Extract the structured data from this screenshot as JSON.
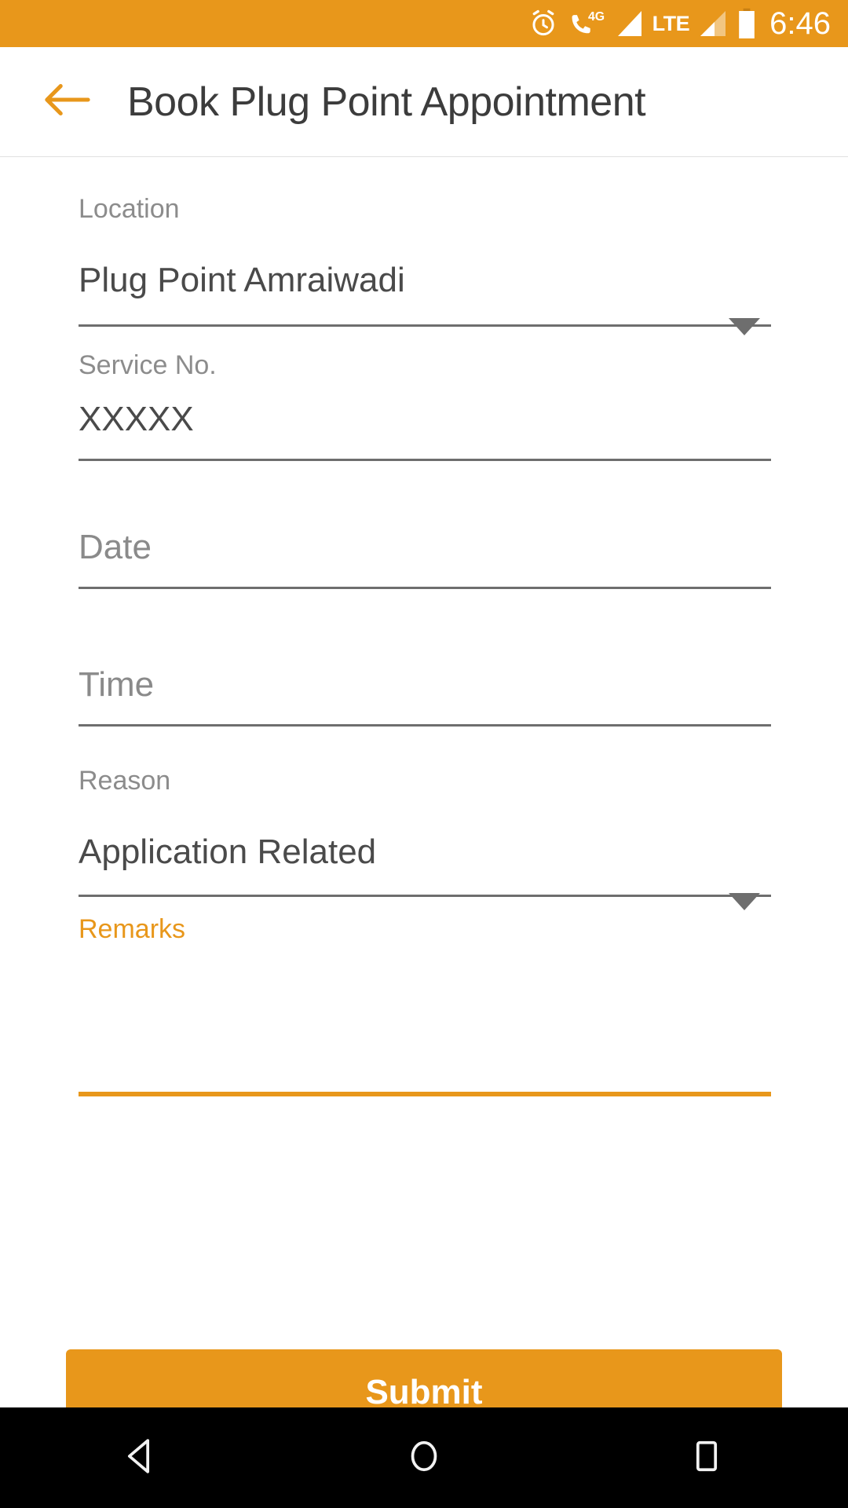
{
  "status_bar": {
    "background_color": "#e8971b",
    "icons": [
      {
        "name": "alarm-clock-icon",
        "label": ""
      },
      {
        "name": "phone-4g-icon",
        "label": "4G"
      },
      {
        "name": "signal-bars-icon-1",
        "label": ""
      },
      {
        "name": "lte-label",
        "label": "LTE"
      },
      {
        "name": "signal-bars-icon-2",
        "label": ""
      },
      {
        "name": "battery-icon",
        "label": ""
      }
    ],
    "time": "6:46"
  },
  "app_bar": {
    "back_icon": "arrow-left-icon",
    "title": "Book Plug Point Appointment",
    "accent_color": "#e8971b",
    "title_color": "#3c3c3c"
  },
  "form": {
    "location": {
      "label": "Location",
      "value": "Plug Point Amraiwadi",
      "caret_icon": "chevron-down-icon"
    },
    "service_no": {
      "label": "Service No.",
      "value": "XXXXX"
    },
    "date": {
      "label": "",
      "placeholder": "Date",
      "value": ""
    },
    "time": {
      "label": "",
      "placeholder": "Time",
      "value": ""
    },
    "reason": {
      "label": "Reason",
      "value": "Application Related",
      "caret_icon": "chevron-down-icon"
    },
    "remarks": {
      "label": "Remarks",
      "value": "",
      "focused": true,
      "focus_color": "#e8971b"
    }
  },
  "submit": {
    "label": "Submit",
    "background_color": "#e8971b",
    "text_color": "#ffffff"
  },
  "nav_bar": {
    "background_color": "#000000",
    "buttons": [
      {
        "name": "nav-back-button",
        "icon": "triangle-left-icon"
      },
      {
        "name": "nav-home-button",
        "icon": "circle-icon"
      },
      {
        "name": "nav-recents-button",
        "icon": "square-icon"
      }
    ]
  }
}
